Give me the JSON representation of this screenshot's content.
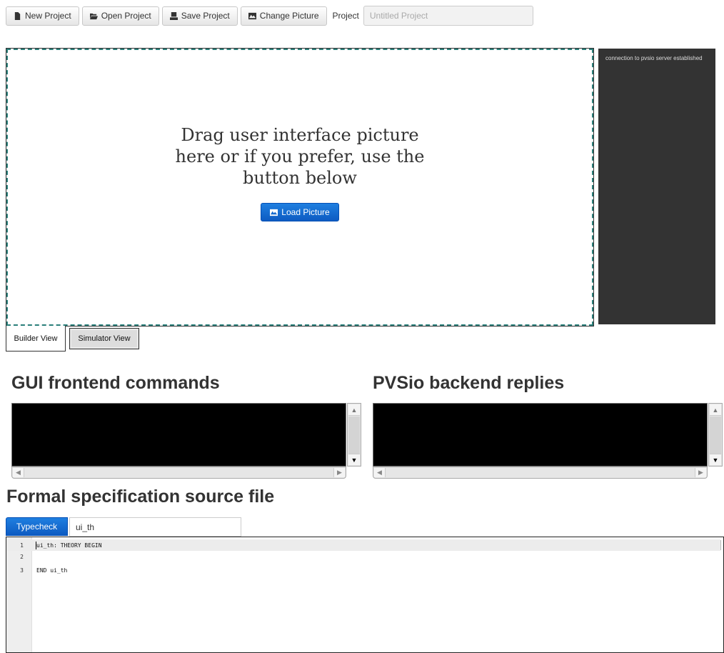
{
  "toolbar": {
    "new_project": "New Project",
    "open_project": "Open Project",
    "save_project": "Save Project",
    "change_picture": "Change Picture",
    "project_label": "Project",
    "project_placeholder": "Untitled Project"
  },
  "dropzone": {
    "message": "Drag user interface picture here or if you prefer, use the button below",
    "load_button": "Load Picture"
  },
  "console": {
    "message": "connection to pvsio server established"
  },
  "views": {
    "builder": "Builder View",
    "simulator": "Simulator View"
  },
  "sections": {
    "gui_commands": "GUI frontend commands",
    "backend_replies": "PVSio backend replies",
    "spec_file": "Formal specification source file"
  },
  "spec": {
    "typecheck_button": "Typecheck",
    "theory_name": "ui_th",
    "lines": [
      {
        "number": "1",
        "text": "ui_th: THEORY BEGIN"
      },
      {
        "number": "2",
        "text": ""
      },
      {
        "number": "3",
        "text": "END ui_th"
      }
    ]
  },
  "colors": {
    "dashed_border": "#2a7f7a",
    "primary_button": "#1f7fe0",
    "console_bg": "#333333",
    "log_bg": "#000000"
  },
  "icons": {
    "new_project": "file-icon",
    "open_project": "folder-open-icon",
    "save_project": "save-icon",
    "change_picture": "picture-icon",
    "load_picture": "picture-icon"
  }
}
